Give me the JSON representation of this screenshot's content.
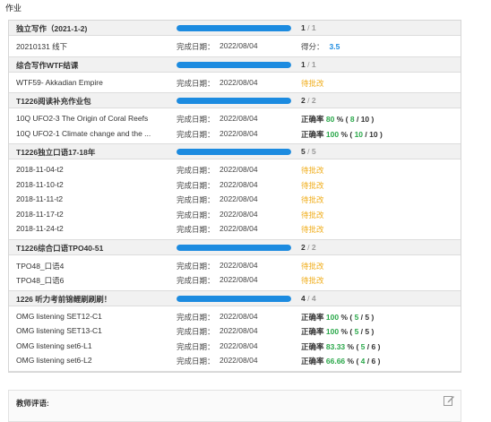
{
  "page_title": "作业",
  "date_label": "完成日期：",
  "score_label": "得分：",
  "accuracy_label": "正确率",
  "groups": [
    {
      "title": "独立写作（2021-1-2)",
      "progress": {
        "done": "1",
        "total": "1",
        "fraction": 1.0
      },
      "rows": [
        {
          "name": "20210131 线下",
          "date": "2022/08/04",
          "kind": "score",
          "score": "3.5"
        }
      ]
    },
    {
      "title": "综合写作WTF结课",
      "progress": {
        "done": "1",
        "total": "1",
        "fraction": 1.0
      },
      "rows": [
        {
          "name": "WTF59- Akkadian Empire",
          "date": "2022/08/04",
          "kind": "status",
          "status": "待批改"
        }
      ]
    },
    {
      "title": "T1226阅读补充作业包",
      "progress": {
        "done": "2",
        "total": "2",
        "fraction": 1.0
      },
      "rows": [
        {
          "name": "10Q UFO2-3 The Origin of Coral Reefs",
          "date": "2022/08/04",
          "kind": "accuracy",
          "pct": "80",
          "correct": "8",
          "total": "10"
        },
        {
          "name": "10Q UFO2-1 Climate change and the ...",
          "date": "2022/08/04",
          "kind": "accuracy",
          "pct": "100",
          "correct": "10",
          "total": "10"
        }
      ]
    },
    {
      "title": "T1226独立口语17-18年",
      "progress": {
        "done": "5",
        "total": "5",
        "fraction": 1.0
      },
      "rows": [
        {
          "name": "2018-11-04-t2",
          "date": "2022/08/04",
          "kind": "status",
          "status": "待批改"
        },
        {
          "name": "2018-11-10-t2",
          "date": "2022/08/04",
          "kind": "status",
          "status": "待批改"
        },
        {
          "name": "2018-11-11-t2",
          "date": "2022/08/04",
          "kind": "status",
          "status": "待批改"
        },
        {
          "name": "2018-11-17-t2",
          "date": "2022/08/04",
          "kind": "status",
          "status": "待批改"
        },
        {
          "name": "2018-11-24-t2",
          "date": "2022/08/04",
          "kind": "status",
          "status": "待批改"
        }
      ]
    },
    {
      "title": "T1226综合口语TPO40-51",
      "progress": {
        "done": "2",
        "total": "2",
        "fraction": 1.0
      },
      "rows": [
        {
          "name": "TPO48_口语4",
          "date": "2022/08/04",
          "kind": "status",
          "status": "待批改"
        },
        {
          "name": "TPO48_口语6",
          "date": "2022/08/04",
          "kind": "status",
          "status": "待批改"
        }
      ]
    },
    {
      "title": "1226 听力考前锦鲤刷刷刷！",
      "progress": {
        "done": "4",
        "total": "4",
        "fraction": 1.0
      },
      "rows": [
        {
          "name": "OMG listening SET12-C1",
          "date": "2022/08/04",
          "kind": "accuracy",
          "pct": "100",
          "correct": "5",
          "total": "5"
        },
        {
          "name": "OMG listening SET13-C1",
          "date": "2022/08/04",
          "kind": "accuracy",
          "pct": "100",
          "correct": "5",
          "total": "5"
        },
        {
          "name": "OMG listening set6-L1",
          "date": "2022/08/04",
          "kind": "accuracy",
          "pct": "83.33",
          "correct": "5",
          "total": "6"
        },
        {
          "name": "OMG listening set6-L2",
          "date": "2022/08/04",
          "kind": "accuracy",
          "pct": "66.66",
          "correct": "4",
          "total": "6"
        }
      ]
    }
  ],
  "comment": {
    "label": "教师评语:",
    "icon": "edit-icon"
  },
  "colors": {
    "progress": "#1c8be0",
    "pending": "#f0ad1a",
    "correct": "#2aa84a",
    "score": "#1c8be0"
  }
}
